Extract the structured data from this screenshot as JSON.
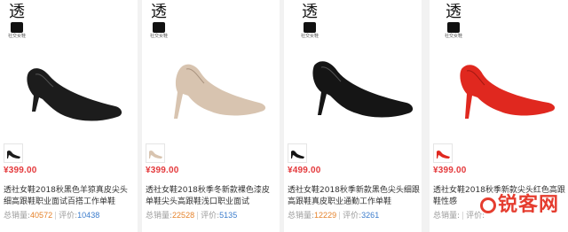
{
  "brand": {
    "mark": "透",
    "caption": "社交女鞋"
  },
  "products": [
    {
      "price": "¥399.00",
      "title": "透社女鞋2018秋黑色羊猄真皮尖头细高跟鞋职业面试百搭工作单鞋",
      "sales_label": "总销量:",
      "sales": "40572",
      "reviews_label": "评价:",
      "reviews": "10438",
      "color": "#1c1c1c"
    },
    {
      "price": "¥399.00",
      "title": "透社女鞋2018秋季冬新款裸色漆皮单鞋尖头高跟鞋浅口职业面试",
      "sales_label": "总销量:",
      "sales": "22528",
      "reviews_label": "评价:",
      "reviews": "5135",
      "color": "#d8c4b0"
    },
    {
      "price": "¥499.00",
      "title": "透社女鞋2018秋季新款黑色尖头细跟高跟鞋真皮职业通勤工作单鞋",
      "sales_label": "总销量:",
      "sales": "12229",
      "reviews_label": "评价:",
      "reviews": "3261",
      "color": "#151515"
    },
    {
      "price": "¥399.00",
      "title": "透社女鞋2018秋季新款尖头红色高跟鞋性感",
      "sales_label": "总销量:",
      "sales": "",
      "reviews_label": "评价:",
      "reviews": "",
      "color": "#e0281f"
    }
  ],
  "watermark": "锐客网"
}
